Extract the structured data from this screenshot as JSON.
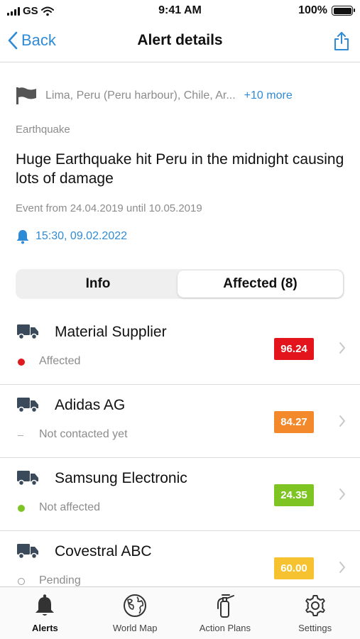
{
  "status_bar": {
    "carrier": "GS",
    "time": "9:41 AM",
    "battery": "100%"
  },
  "nav": {
    "back_label": "Back",
    "title": "Alert details"
  },
  "alert": {
    "locations": "Lima, Peru (Peru harbour), Chile, Ar...",
    "more": "+10 more",
    "category": "Earthquake",
    "headline": "Huge Earthquake hit Peru in the midnight causing lots of damage",
    "event_range": "Event from 24.04.2019 until 10.05.2019",
    "notified_at": "15:30, 09.02.2022"
  },
  "segments": {
    "info": "Info",
    "affected": "Affected (8)",
    "selected": "affected"
  },
  "suppliers": [
    {
      "name": "Material Supplier",
      "status": "Affected",
      "indicator": "dot",
      "indicator_color": "#e0191f",
      "score": "96.24",
      "score_color": "#e3141c"
    },
    {
      "name": "Adidas AG",
      "status": "Not contacted yet",
      "indicator": "dash",
      "indicator_color": "#aaaaaa",
      "score": "84.27",
      "score_color": "#f3892a"
    },
    {
      "name": "Samsung Electronic",
      "status": "Not affected",
      "indicator": "dot",
      "indicator_color": "#7ec523",
      "score": "24.35",
      "score_color": "#7ec523"
    },
    {
      "name": "Covestral ABC",
      "status": "Pending",
      "indicator": "ring",
      "indicator_color": "#999999",
      "score": "60.00",
      "score_color": "#f6c230"
    }
  ],
  "tabs": [
    {
      "label": "Alerts",
      "icon": "bell-icon",
      "active": true
    },
    {
      "label": "World Map",
      "icon": "globe-icon",
      "active": false
    },
    {
      "label": "Action Plans",
      "icon": "fire-extinguisher-icon",
      "active": false
    },
    {
      "label": "Settings",
      "icon": "gear-icon",
      "active": false
    }
  ],
  "colors": {
    "accent": "#2f8bd6",
    "muted_text": "#8c8c8c"
  }
}
